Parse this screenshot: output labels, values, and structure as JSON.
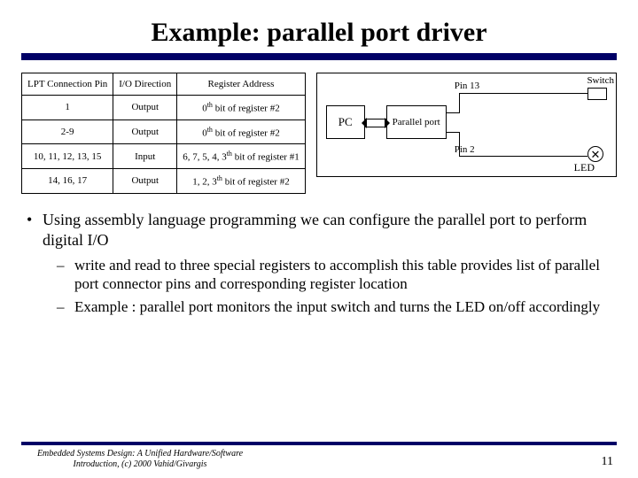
{
  "title": "Example: parallel port driver",
  "table": {
    "headers": [
      "LPT Connection Pin",
      "I/O Direction",
      "Register Address"
    ],
    "rows": [
      {
        "pin": "1",
        "dir": "Output",
        "reg_pre": "0",
        "reg_post": " bit of register #2"
      },
      {
        "pin": "2-9",
        "dir": "Output",
        "reg_pre": "0",
        "reg_post": " bit of register #2"
      },
      {
        "pin": "10, 11, 12, 13, 15",
        "dir": "Input",
        "reg_pre": "6, 7, 5, 4, 3",
        "reg_post": " bit of register #1"
      },
      {
        "pin": "14, 16, 17",
        "dir": "Output",
        "reg_pre": "1, 2, 3",
        "reg_post": " bit of register #2"
      }
    ],
    "th_super": "th"
  },
  "diagram": {
    "pc": "PC",
    "pp": "Parallel port",
    "pin13": "Pin 13",
    "pin2": "Pin 2",
    "switch": "Switch",
    "led": "LED"
  },
  "bullets": {
    "b1": "Using assembly language programming we can configure the parallel port to perform digital I/O",
    "b2a": "write and read to three special registers to accomplish this table provides list of parallel port connector pins and corresponding register location",
    "b2b": "Example : parallel port monitors the input switch and turns the LED on/off accordingly"
  },
  "footer": {
    "text": "Embedded Systems Design: A Unified Hardware/Software Introduction, (c) 2000 Vahid/Givargis",
    "page": "11"
  }
}
